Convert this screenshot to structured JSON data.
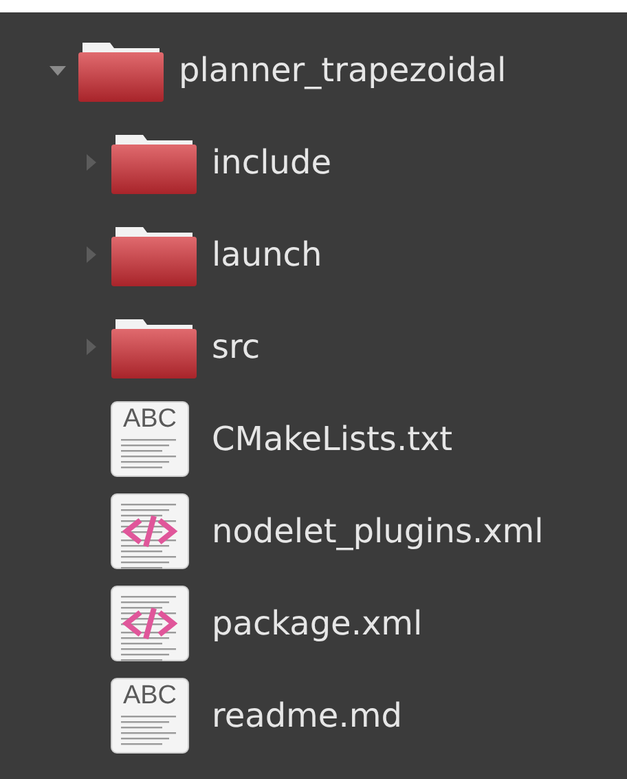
{
  "tree": [
    {
      "label": "planner_trapezoidal",
      "kind": "folder",
      "expanded": true,
      "children": [
        {
          "label": "include",
          "kind": "folder",
          "expanded": false
        },
        {
          "label": "launch",
          "kind": "folder",
          "expanded": false
        },
        {
          "label": "src",
          "kind": "folder",
          "expanded": false
        },
        {
          "label": "CMakeLists.txt",
          "kind": "text",
          "icon_text": "ABC"
        },
        {
          "label": "nodelet_plugins.xml",
          "kind": "code"
        },
        {
          "label": "package.xml",
          "kind": "code"
        },
        {
          "label": "readme.md",
          "kind": "text",
          "icon_text": "ABC"
        }
      ]
    }
  ]
}
